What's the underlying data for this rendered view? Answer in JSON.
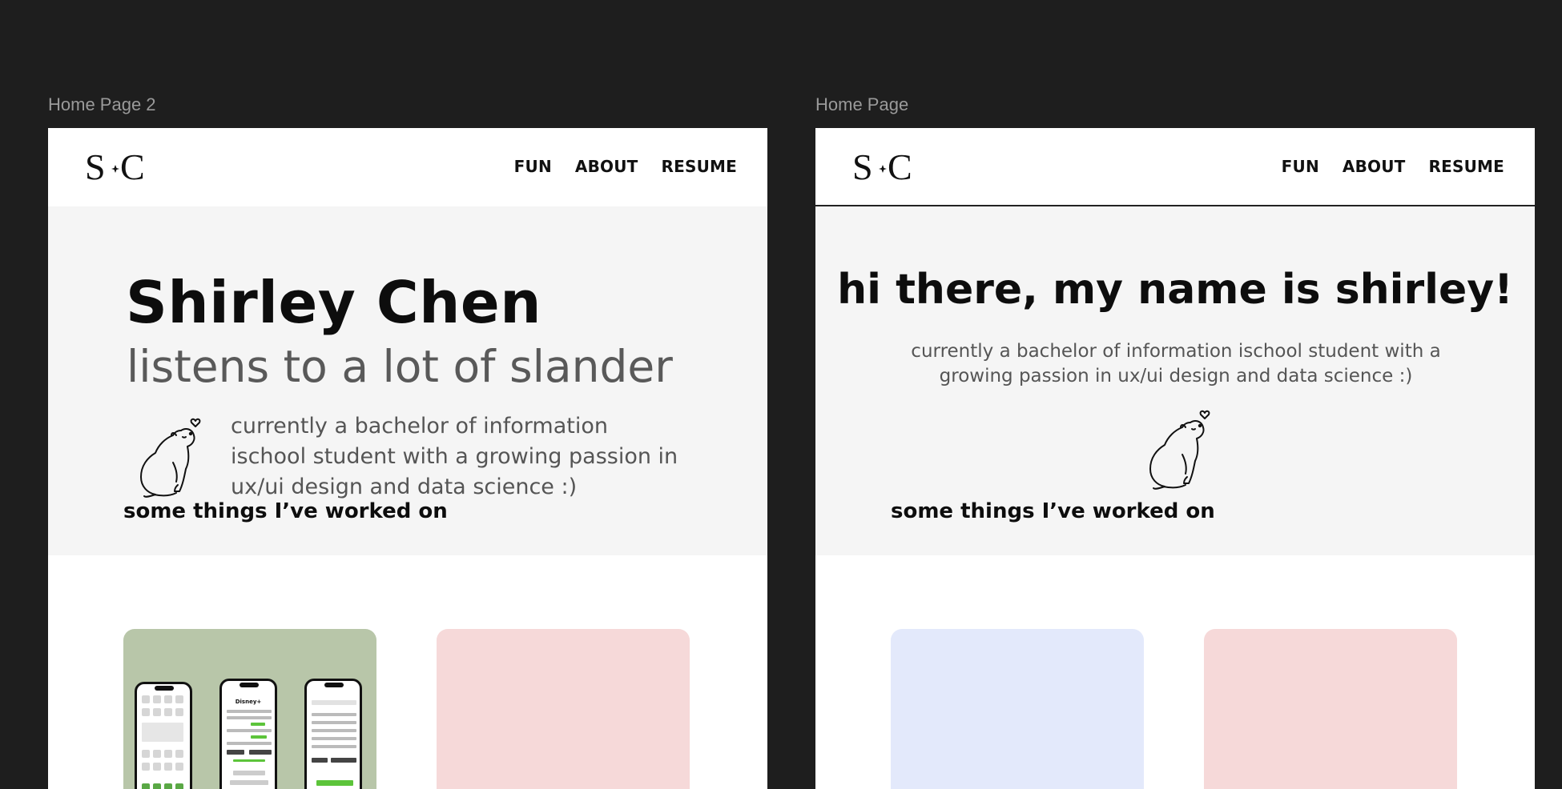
{
  "frames": [
    {
      "label": "Home Page 2",
      "logo": "S·C",
      "nav": [
        "FUN",
        "ABOUT",
        "RESUME"
      ],
      "hero": {
        "name": "Shirley Chen",
        "subtitle": "listens to a lot of slander",
        "description": "currently a bachelor of information ischool student with a growing passion in ux/ui design and data science :)"
      },
      "section_title": "some things I’ve worked on",
      "card_colors": [
        "#b8c6a9",
        "#f6d9d9"
      ],
      "phone_app_title": "Disney+"
    },
    {
      "label": "Home Page",
      "logo": "S·C",
      "nav": [
        "FUN",
        "ABOUT",
        "RESUME"
      ],
      "hero": {
        "title": "hi there, my name is shirley!",
        "description": "currently a bachelor of information ischool student with a growing passion in ux/ui design and data science :)"
      },
      "section_title": "some things I’ve worked on",
      "card_colors": [
        "#e3e9fb",
        "#f6d9d9"
      ]
    }
  ],
  "colors": {
    "canvas": "#1e1e1e",
    "hero_bg": "#f5f5f5",
    "text_dark": "#0d0d0d",
    "text_muted": "#555555"
  },
  "icons": [
    "bear-with-heart-illustration"
  ]
}
